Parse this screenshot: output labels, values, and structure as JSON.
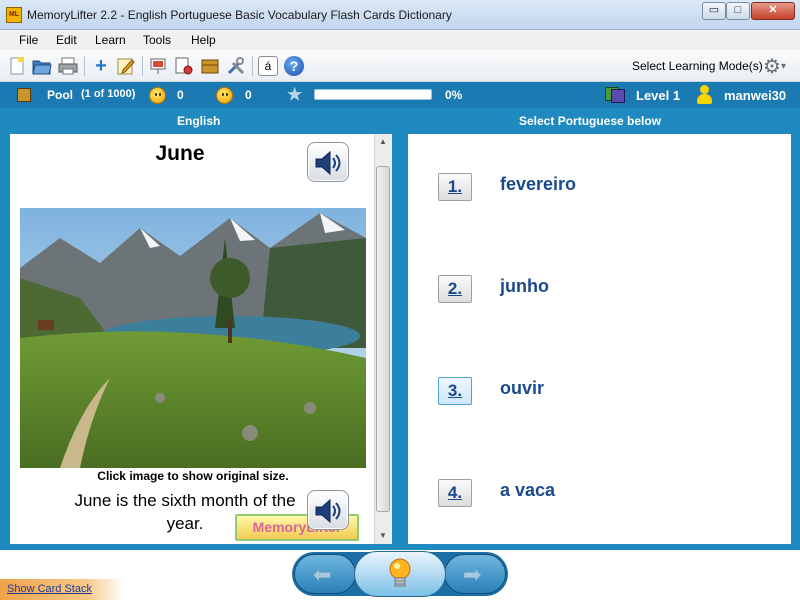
{
  "window": {
    "title": "MemoryLifter 2.2 - English Portuguese Basic Vocabulary Flash Cards Dictionary",
    "app_icon_text": "ML",
    "min_glyph": "▭",
    "max_glyph": "□",
    "close_glyph": "✕"
  },
  "menu": {
    "items": [
      "File",
      "Edit",
      "Learn",
      "Tools",
      "Help"
    ]
  },
  "toolbar": {
    "buttons": [
      "new-icon",
      "open-icon",
      "print-icon",
      "add-card-icon",
      "edit-icon",
      "presentation-icon",
      "statistics-icon",
      "box-icon",
      "settings-tools-icon",
      "special-char-icon",
      "help-icon"
    ],
    "special_char_glyph": "á",
    "help_glyph": "?",
    "add_glyph": "+",
    "select_mode_label": "Select Learning Mode(s)",
    "gear_glyph": "⚙",
    "dropdown_glyph": "▾"
  },
  "status": {
    "pool_label": "Pool",
    "pool_count": "(1 of 1000)",
    "correct_count": "0",
    "wrong_count": "0",
    "star_glyph": "★",
    "progress_percent_label": "0%",
    "progress_fraction": 0,
    "level_label": "Level 1",
    "user_name": "manwei30"
  },
  "question": {
    "column_title": "English",
    "word": "June",
    "image_caption": "Click image to show original size.",
    "example_sentence": "June is the sixth month of the year.",
    "watermark_text": "MemoryLifter"
  },
  "answers": {
    "column_title": "Select Portuguese below",
    "options": [
      {
        "number": "1.",
        "text": "fevereiro"
      },
      {
        "number": "2.",
        "text": "junho"
      },
      {
        "number": "3.",
        "text": "ouvir"
      },
      {
        "number": "4.",
        "text": "a vaca"
      }
    ]
  },
  "navigation": {
    "prev_glyph": "⬅",
    "next_glyph": "➡",
    "show_card_stack": "Show Card Stack"
  },
  "colors": {
    "panel_blue": "#1f8ac0",
    "status_blue": "#1b7ab1",
    "answer_text": "#1a4a8e"
  }
}
